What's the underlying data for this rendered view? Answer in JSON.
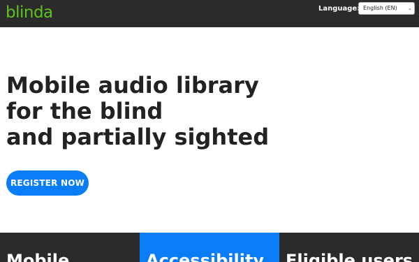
{
  "header": {
    "logo": "blinda",
    "language_label": "Language:",
    "language_selected": "English (EN)"
  },
  "hero": {
    "title_lines": [
      "Mobile audio library",
      "for the blind",
      "and partially sighted"
    ],
    "cta_label": "REGISTER NOW"
  },
  "tiles": [
    {
      "title": "Mobile"
    },
    {
      "title": "Accessibility"
    },
    {
      "title": "Eligible users"
    }
  ],
  "colors": {
    "header_bg": "#2b2b2b",
    "logo": "#5fc31f",
    "accent": "#0a7cf5",
    "text": "#222222"
  },
  "icons": {
    "select_caret": "chevron-down-icon"
  }
}
